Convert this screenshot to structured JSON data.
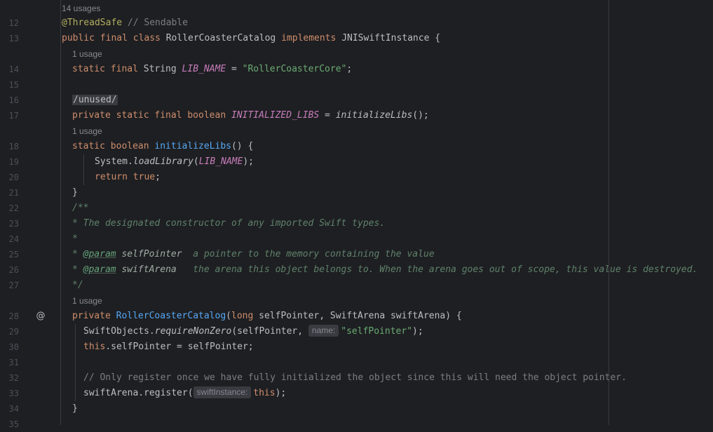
{
  "usages": {
    "top": "14 usages",
    "lib_name": "1 usage",
    "initialize": "1 usage",
    "ctor": "1 usage"
  },
  "line_numbers": [
    "12",
    "13",
    "14",
    "15",
    "16",
    "17",
    "18",
    "19",
    "20",
    "21",
    "22",
    "23",
    "24",
    "25",
    "26",
    "27",
    "28",
    "29",
    "30",
    "31",
    "32",
    "33",
    "34",
    "35"
  ],
  "code": {
    "l12_ann": "@ThreadSafe",
    "l12_cm": " // Sendable",
    "l13_kw": "public final class ",
    "l13_name": "RollerCoasterCatalog ",
    "l13_kw2": "implements ",
    "l13_rest": "JNISwiftInstance {",
    "l14_kw": "static final ",
    "l14_type": "String ",
    "l14_field": "LIB_NAME",
    "l14_eq": " = ",
    "l14_str": "\"RollerCoasterCore\"",
    "l14_end": ";",
    "l16_region": "/unused/",
    "l17_kw": "private static final boolean ",
    "l17_field": "INITIALIZED_LIBS",
    "l17_eq": " = ",
    "l17_call": "initializeLibs",
    "l17_end": "();",
    "l18_kw": "static boolean ",
    "l18_name": "initializeLibs",
    "l18_end": "() {",
    "l19_a": "System.",
    "l19_b": "loadLibrary",
    "l19_c": "(",
    "l19_d": "LIB_NAME",
    "l19_e": ");",
    "l20_kw": "return true",
    "l20_end": ";",
    "l21": "}",
    "l22": "/**",
    "l23": "* The designated constructor of any imported Swift types.",
    "l24": "*",
    "l25_a": "* ",
    "l25_tag": "@param",
    "l25_p": " selfPointer",
    "l25_d": "  a pointer to the memory containing the value",
    "l26_a": "* ",
    "l26_tag": "@param",
    "l26_p": " swiftArena",
    "l26_d": "   the arena this object belongs to. When the arena goes out of scope, this value is destroyed.",
    "l27": "*/",
    "l28_kw": "private ",
    "l28_name": "RollerCoasterCatalog",
    "l28_a": "(",
    "l28_kw2": "long ",
    "l28_b": "selfPointer, SwiftArena swiftArena) {",
    "l29_a": "SwiftObjects.",
    "l29_b": "requireNonZero",
    "l29_c": "(selfPointer, ",
    "l29_hint": "name:",
    "l29_str": "\"selfPointer\"",
    "l29_end": ");",
    "l30_kw": "this",
    "l30_rest": ".selfPointer = selfPointer;",
    "l32_cm": "// Only register once we have fully initialized the object since this will need the object pointer.",
    "l33_a": "swiftArena.register(",
    "l33_hint": "swiftInstance:",
    "l33_kw": "this",
    "l33_end": ");",
    "l34": "}"
  },
  "gutter_icons": {
    "l28": "@"
  },
  "colors": {
    "background": "#1e1f22",
    "keyword": "#cf8e6d",
    "string": "#6aab73",
    "annotation": "#b3ae60",
    "comment": "#7a7e85",
    "doc_comment": "#5f826b",
    "field": "#c77dbb",
    "method_decl": "#56a8f5"
  }
}
